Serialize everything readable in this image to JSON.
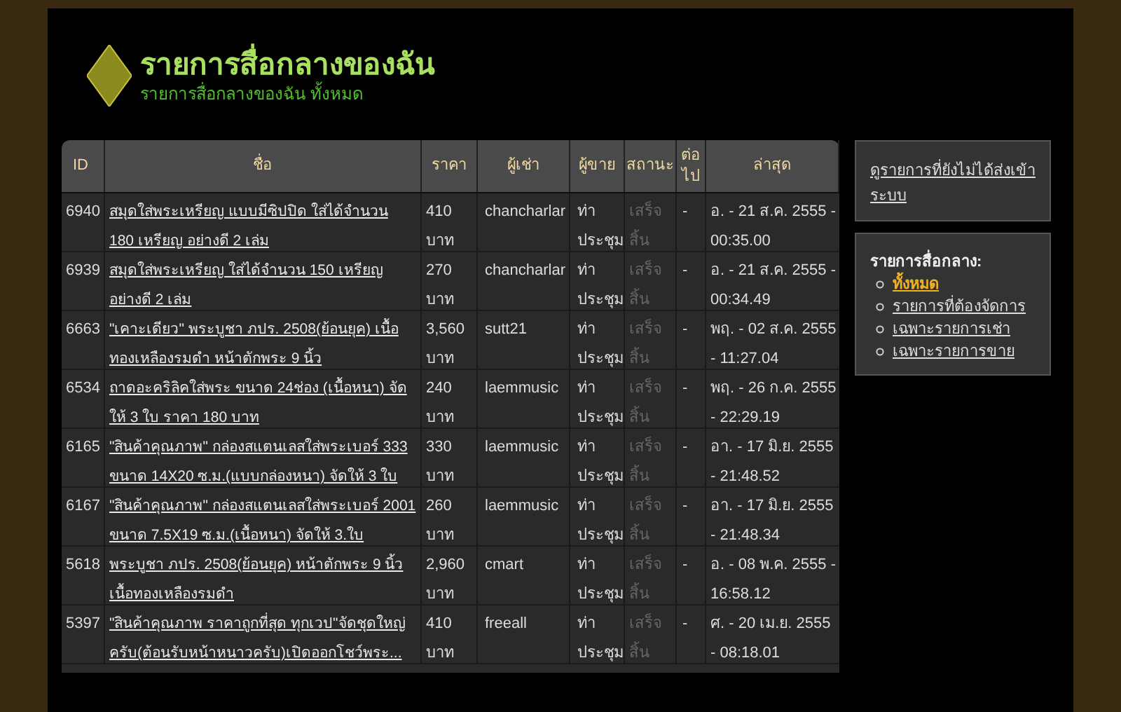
{
  "header": {
    "title": "รายการสื่อกลางของฉัน",
    "subtitle": "รายการสื่อกลางของฉัน ทั้งหมด"
  },
  "table": {
    "columns": [
      "ID",
      "ชื่อ",
      "ราคา",
      "ผู้เช่า",
      "ผู้ขาย",
      "สถานะ",
      "ต่อไป",
      "ล่าสุด"
    ],
    "rows": [
      {
        "id": "6940",
        "name": "สมุดใส่พระเหรียญ แบบมีซิปปิด ใส่ได้จำนวน 180 เหรียญ อย่างดี 2 เล่ม",
        "price": "410 บาท",
        "renter": "chancharlar",
        "seller": "ท่าประชุม",
        "status": "เสร็จสิ้น",
        "next": "-",
        "latest": "อ. - 21 ส.ค. 2555 - 00:35.00"
      },
      {
        "id": "6939",
        "name": "สมุดใส่พระเหรียญ ใส่ได้จำนวน 150 เหรียญ อย่างดี 2 เล่ม",
        "price": "270 บาท",
        "renter": "chancharlar",
        "seller": "ท่าประชุม",
        "status": "เสร็จสิ้น",
        "next": "-",
        "latest": "อ. - 21 ส.ค. 2555 - 00:34.49"
      },
      {
        "id": "6663",
        "name": "\"เคาะเดียว\" พระบูชา ภปร. 2508(ย้อนยุค) เนื้อทองเหลืองรมดำ หน้าตักพระ 9 นิ้ว",
        "price": "3,560 บาท",
        "renter": "sutt21",
        "seller": "ท่าประชุม",
        "status": "เสร็จสิ้น",
        "next": "-",
        "latest": "พฤ. - 02 ส.ค. 2555 - 11:27.04"
      },
      {
        "id": "6534",
        "name": "ถาดอะคริลิคใส่พระ ขนาด 24ช่อง (เนื้อหนา) จัดให้ 3 ใบ ราคา 180 บาท",
        "price": "240 บาท",
        "renter": "laemmusic",
        "seller": "ท่าประชุม",
        "status": "เสร็จสิ้น",
        "next": "-",
        "latest": "พฤ. - 26 ก.ค. 2555 - 22:29.19"
      },
      {
        "id": "6165",
        "name": "\"สินค้าคุณภาพ\" กล่องสแตนเลสใส่พระเบอร์ 333 ขนาด 14X20 ซ.ม.(แบบกล่องหนา) จัดให้ 3 ใบ",
        "price": "330 บาท",
        "renter": "laemmusic",
        "seller": "ท่าประชุม",
        "status": "เสร็จสิ้น",
        "next": "-",
        "latest": "อา. - 17 มิ.ย. 2555 - 21:48.52"
      },
      {
        "id": "6167",
        "name": "\"สินค้าคุณภาพ\" กล่องสแตนเลสใส่พระเบอร์ 2001 ขนาด 7.5X19 ซ.ม.(เนื้อหนา) จัดให้ 3.ใบ",
        "price": "260 บาท",
        "renter": "laemmusic",
        "seller": "ท่าประชุม",
        "status": "เสร็จสิ้น",
        "next": "-",
        "latest": "อา. - 17 มิ.ย. 2555 - 21:48.34"
      },
      {
        "id": "5618",
        "name": "พระบูชา ภปร. 2508(ย้อนยุค) หน้าตักพระ 9 นิ้ว เนื้อทองเหลืองรมดำ",
        "price": "2,960 บาท",
        "renter": "cmart",
        "seller": "ท่าประชุม",
        "status": "เสร็จสิ้น",
        "next": "-",
        "latest": "อ. - 08 พ.ค. 2555 - 16:58.12"
      },
      {
        "id": "5397",
        "name": "\"สินค้าคุณภาพ ราคาถูกที่สุด ทุกเวป\"จัดชุดใหญ่ครับ(ต้อนรับหน้าหนาวครับ)เปิดออกโชว์พระ...",
        "price": "410 บาท",
        "renter": "freeall",
        "seller": "ท่าประชุม",
        "status": "เสร็จสิ้น",
        "next": "-",
        "latest": "ศ. - 20 เม.ย. 2555 - 08:18.01"
      }
    ]
  },
  "sidebar": {
    "notice_link": "ดูรายการที่ยังไม่ได้ส่งเข้าระบบ",
    "menu_title": "รายการสื่อกลาง:",
    "items": [
      {
        "label": "ทั้งหมด",
        "selected": true
      },
      {
        "label": "รายการที่ต้องจัดการ",
        "selected": false
      },
      {
        "label": "เฉพาะรายการเช่า",
        "selected": false
      },
      {
        "label": "เฉพาะรายการขาย",
        "selected": false
      }
    ]
  }
}
